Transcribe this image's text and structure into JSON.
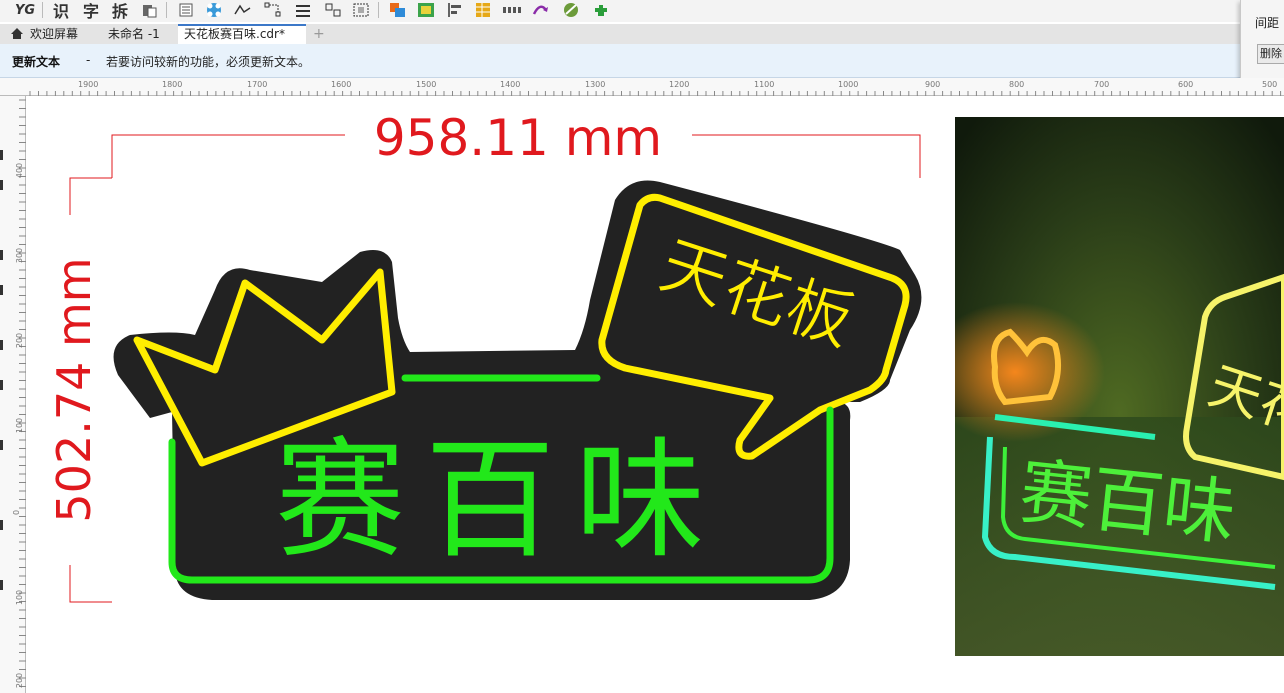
{
  "toolbar": {
    "logo": "YG",
    "recognize": "识",
    "char": "字",
    "split": "拆"
  },
  "side_panel": {
    "spacing_label": "间距",
    "delete_button": "删除"
  },
  "tabs": [
    {
      "label": "欢迎屏幕"
    },
    {
      "label": "未命名 -1"
    },
    {
      "label": "天花板赛百味.cdr*"
    }
  ],
  "info_bar": {
    "title": "更新文本",
    "separator": "-",
    "message": "若要访问较新的功能，必须更新文本。"
  },
  "ruler_h_ticks": [
    "1900",
    "1800",
    "1700",
    "1600",
    "1500",
    "1400",
    "1300",
    "1200",
    "1100",
    "1000",
    "900",
    "800",
    "700",
    "600",
    "500"
  ],
  "ruler_v_ticks": [
    "400",
    "300",
    "200",
    "100",
    "0",
    "100",
    "200"
  ],
  "design": {
    "width_dim": "958.11 mm",
    "height_dim": "502.74 mm",
    "sign_top_text": "天花板",
    "sign_main_text": "赛百味",
    "colors": {
      "dimension": "#e0191e",
      "backing": "#222222",
      "neon_yellow": "#ffee00",
      "neon_green": "#22e81a"
    }
  },
  "photo": {
    "top_text": "天花",
    "main_text": "赛百味"
  }
}
